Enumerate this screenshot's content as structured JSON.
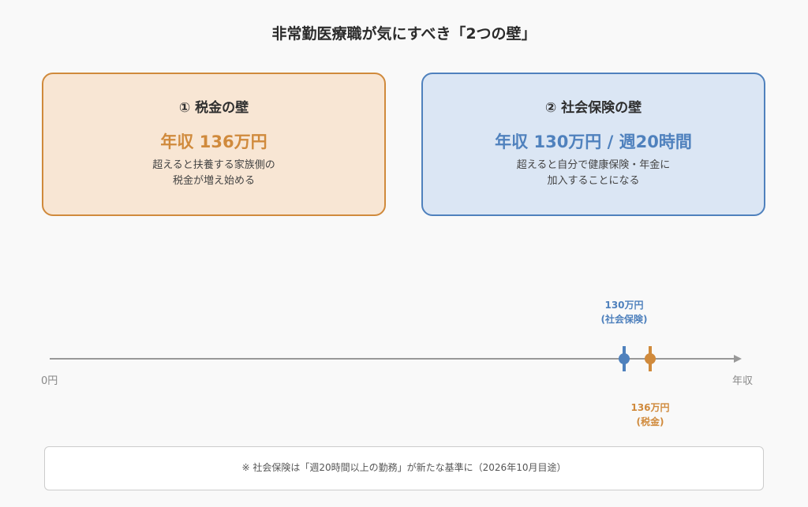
{
  "title": "非常勤医療職が気にすべき「2つの壁」",
  "cards": {
    "tax": {
      "heading": "① 税金の壁",
      "value": "年収 136万円",
      "desc_line1": "超えると扶養する家族側の",
      "desc_line2": "税金が増え始める"
    },
    "social": {
      "heading": "② 社会保険の壁",
      "value": "年収 130万円 / 週20時間",
      "desc_line1": "超えると自分で健康保険・年金に",
      "desc_line2": "加入することになる"
    }
  },
  "timeline": {
    "start_label": "0円",
    "end_label": "年収",
    "markers": [
      {
        "id": "social",
        "value": 130,
        "label_line1": "130万円",
        "label_line2": "(社会保険)",
        "color": "#4f81bd"
      },
      {
        "id": "tax",
        "value": 136,
        "label_line1": "136万円",
        "label_line2": "(税金)",
        "color": "#d08a3c"
      }
    ]
  },
  "note": "※ 社会保険は「週20時間以上の勤務」が新たな基準に（2026年10月目途）",
  "colors": {
    "tax_accent": "#d08a3c",
    "tax_bg": "#f8e6d4",
    "social_accent": "#4f81bd",
    "social_bg": "#dbe6f4",
    "axis": "#999999"
  }
}
